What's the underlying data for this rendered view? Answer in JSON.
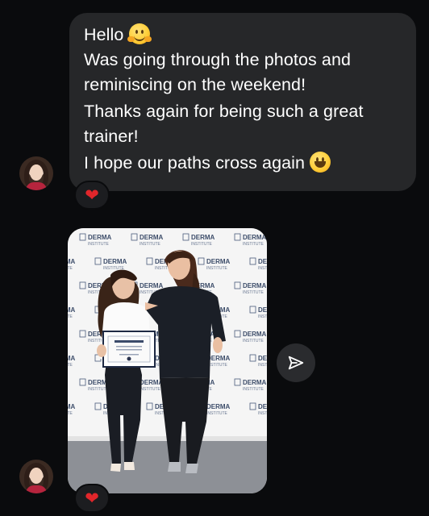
{
  "message": {
    "line1": "Hello",
    "line2": "Was going through the photos and reminiscing on the weekend!",
    "line3": "Thanks again for being such a great trainer!",
    "line4": "I hope our paths cross again",
    "emoji1": "hugging-face",
    "emoji2": "smiling-face"
  },
  "reactions": [
    {
      "icon": "heart-icon",
      "glyph": "❤",
      "color": "#e1262b"
    },
    {
      "icon": "heart-icon",
      "glyph": "❤",
      "color": "#e1262b"
    }
  ],
  "photo": {
    "backdrop_brand": "DERMA",
    "backdrop_sub": "INSTITUTE"
  },
  "colors": {
    "background": "#0a0b0d",
    "bubble": "#262729",
    "share_button": "#2a2b2e"
  }
}
